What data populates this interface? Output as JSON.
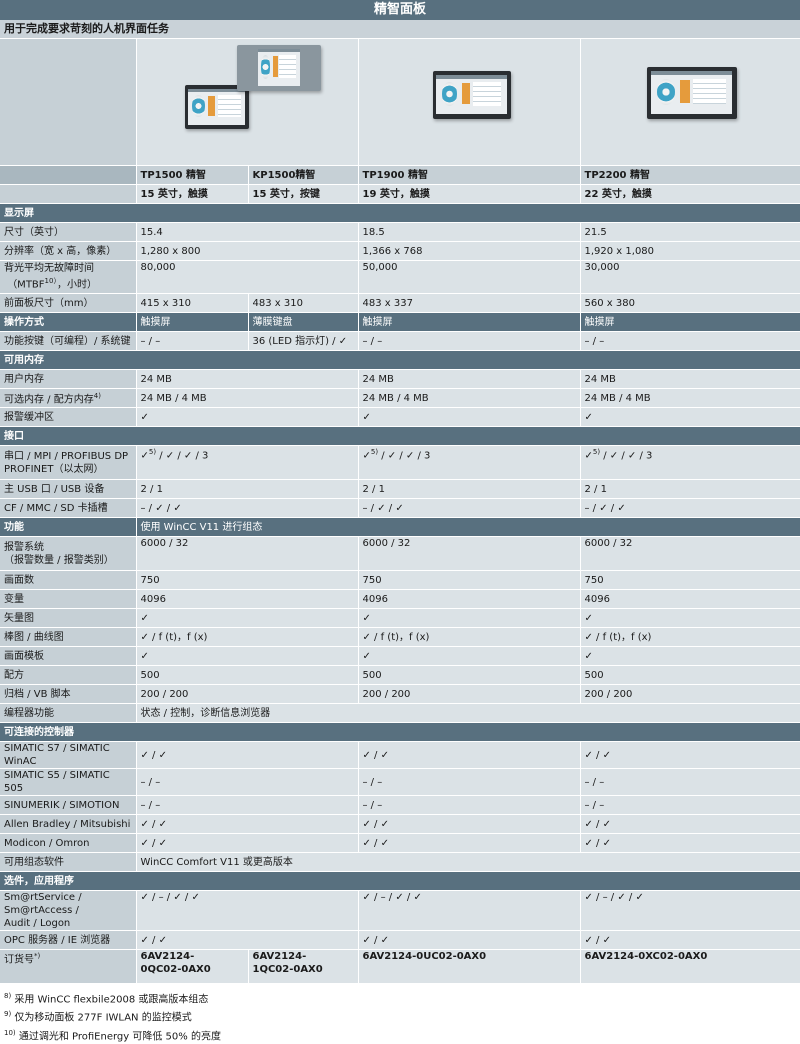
{
  "title": "精智面板",
  "subtitle": "用于完成要求苛刻的人机界面任务",
  "images": [
    {
      "col": "1-2",
      "icon": "tp1500-kp1500-panel-image"
    },
    {
      "col": "3",
      "icon": "tp1900-panel-image"
    },
    {
      "col": "4",
      "icon": "tp2200-panel-image"
    }
  ],
  "models": [
    "TP1500 精智",
    "KP1500精智",
    "TP1900 精智",
    "TP2200 精智"
  ],
  "model_desc": [
    "15 英寸，触摸",
    "15 英寸，按键",
    "19 英寸，触摸",
    "22 英寸，触摸"
  ],
  "sections": {
    "display": "显示屏",
    "operation": "操作方式",
    "memory": "可用内存",
    "interface": "接口",
    "functions": "功能",
    "functions_note": "使用 WinCC V11 进行组态",
    "controllers": "可连接的控制器",
    "options": "选件，应用程序"
  },
  "rows": {
    "size": {
      "label": "尺寸（英寸）",
      "tp1500": "15.4",
      "tp1900": "18.5",
      "tp2200": "21.5"
    },
    "resolution": {
      "label": "分辨率（宽 x 高，像素）",
      "tp1500": "1,280 x 800",
      "tp1900": "1,366 x 768",
      "tp2200": "1,920 x 1,080"
    },
    "mtbf": {
      "label_1": "背光平均无故障时间",
      "label_2a": "（MTBF",
      "label_sup": "10）",
      "label_2b": "，小时）",
      "tp1500": "80,000",
      "tp1900": "50,000",
      "tp2200": "30,000"
    },
    "front": {
      "label": "前面板尺寸（mm）",
      "tp1500": "415 x 310",
      "kp1500": "483 x 310",
      "tp1900": "483 x 337",
      "tp2200": "560 x 380"
    },
    "operation": {
      "tp1500": "触摸屏",
      "kp1500": "薄膜键盘",
      "tp1900": "触摸屏",
      "tp2200": "触摸屏"
    },
    "fkeys": {
      "label": "功能按键（可编程）/ 系统键",
      "tp1500": "– / –",
      "kp1500": "36 (LED 指示灯) / ✓",
      "tp1900": "– / –",
      "tp2200": "– / –"
    },
    "user_mem": {
      "label": "用户内存",
      "tp1500": "24 MB",
      "tp1900": "24 MB",
      "tp2200": "24 MB"
    },
    "opt_mem": {
      "label": "可选内存 / 配方内存",
      "label_sup": "4)",
      "tp1500": "24 MB / 4 MB",
      "tp1900": "24 MB / 4 MB",
      "tp2200": "24 MB / 4 MB"
    },
    "alarm_buf": {
      "label": "报警缓冲区",
      "tp1500": "✓",
      "tp1900": "✓",
      "tp2200": "✓"
    },
    "serial": {
      "label_1": "串口 / MPI / PROFIBUS DP",
      "label_2": "PROFINET（以太网）",
      "v_pre": "✓",
      "v_sup": "5)",
      "v_post": " / ✓ / ✓ / 3"
    },
    "usb": {
      "label": "主 USB 口 / USB 设备",
      "tp1500": "2 / 1",
      "tp1900": "2 / 1",
      "tp2200": "2 / 1"
    },
    "card": {
      "label": "CF / MMC / SD 卡插槽",
      "tp1500": "– / ✓ / ✓",
      "tp1900": "– / ✓ / ✓",
      "tp2200": "– / ✓ / ✓"
    },
    "alarm_sys": {
      "label_1": "报警系统",
      "label_2": "（报警数量 / 报警类别）",
      "tp1500": "6000 / 32",
      "tp1900": "6000 / 32",
      "tp2200": "6000 / 32"
    },
    "screens": {
      "label": "画面数",
      "tp1500": "750",
      "tp1900": "750",
      "tp2200": "750"
    },
    "tags": {
      "label": "变量",
      "tp1500": "4096",
      "tp1900": "4096",
      "tp2200": "4096"
    },
    "vector": {
      "label": "矢量图",
      "tp1500": "✓",
      "tp1900": "✓",
      "tp2200": "✓"
    },
    "bargraph": {
      "label": "棒图 / 曲线图",
      "tp1500": "✓ / f (t)，f (x)",
      "tp1900": "✓ / f (t)，f (x)",
      "tp2200": "✓ / f (t)，f (x)"
    },
    "template": {
      "label": "画面模板",
      "tp1500": "✓",
      "tp1900": "✓",
      "tp2200": "✓"
    },
    "recipes": {
      "label": "配方",
      "tp1500": "500",
      "tp1900": "500",
      "tp2200": "500"
    },
    "archive": {
      "label": "归档 / VB 脚本",
      "tp1500": "200 / 200",
      "tp1900": "200 / 200",
      "tp2200": "200 / 200"
    },
    "programmer": {
      "label": "编程器功能",
      "value": "状态 / 控制，诊断信息浏览器"
    },
    "s7": {
      "label": "SIMATIC S7 / SIMATIC WinAC",
      "tp1500": "✓ / ✓",
      "tp1900": "✓ / ✓",
      "tp2200": "✓ / ✓"
    },
    "s5": {
      "label": "SIMATIC S5 / SIMATIC 505",
      "tp1500": "– / –",
      "tp1900": "– / –",
      "tp2200": "– / –"
    },
    "sinumerik": {
      "label": "SINUMERIK / SIMOTION",
      "tp1500": "– / –",
      "tp1900": "– / –",
      "tp2200": "– / –"
    },
    "ab": {
      "label": "Allen Bradley / Mitsubishi",
      "tp1500": "✓ / ✓",
      "tp1900": "✓ / ✓",
      "tp2200": "✓ / ✓"
    },
    "modicon": {
      "label": "Modicon / Omron",
      "tp1500": "✓ / ✓",
      "tp1900": "✓ / ✓",
      "tp2200": "✓ / ✓"
    },
    "config_sw": {
      "label": "可用组态软件",
      "value": "WinCC Comfort V11 或更高版本"
    },
    "smart": {
      "label_1": "Sm@rtService / Sm@rtAccess /",
      "label_2": "Audit / Logon",
      "tp1500": "✓ / – / ✓ / ✓",
      "tp1900": "✓ / – / ✓ / ✓",
      "tp2200": "✓ / – / ✓ / ✓"
    },
    "opc": {
      "label": "OPC 服务器 / IE 浏览器",
      "tp1500": "✓ / ✓",
      "tp1900": "✓ / ✓",
      "tp2200": "✓ / ✓"
    },
    "order": {
      "label": "订货号",
      "label_sup": "*)",
      "tp1500_1": "6AV2124-",
      "tp1500_2": "0QC02-0AX0",
      "kp1500_1": "6AV2124-",
      "kp1500_2": "1QC02-0AX0",
      "tp1900": "6AV2124-0UC02-0AX0",
      "tp2200": "6AV2124-0XC02-0AX0"
    }
  },
  "footnotes": [
    {
      "mark": "8)",
      "text": "采用 WinCC flexbile2008 或跟高版本组态"
    },
    {
      "mark": "9)",
      "text": "仅为移动面板 277F IWLAN 的监控模式"
    },
    {
      "mark": "10)",
      "text": "通过调光和 ProfiEnergy 可降低 50% 的亮度"
    }
  ]
}
